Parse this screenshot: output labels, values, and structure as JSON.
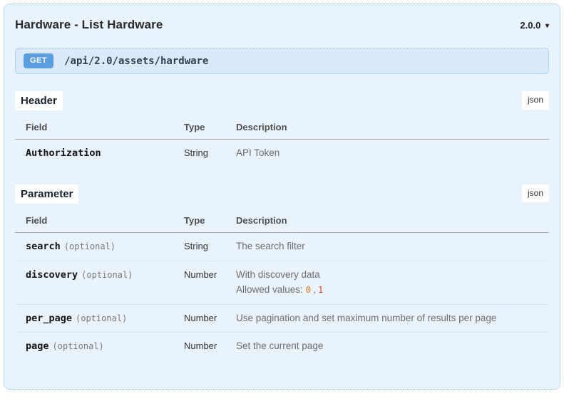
{
  "page": {
    "title": "Hardware - List Hardware",
    "version": "2.0.0",
    "version_caret": "▾"
  },
  "endpoint": {
    "method": "GET",
    "path": "/api/2.0/assets/hardware"
  },
  "header_section": {
    "heading": "Header",
    "json_button_label": "json",
    "columns": {
      "field": "Field",
      "type": "Type",
      "description": "Description"
    },
    "rows": [
      {
        "field": "Authorization",
        "type": "String",
        "description": "API Token"
      }
    ]
  },
  "parameter_section": {
    "heading": "Parameter",
    "json_button_label": "json",
    "columns": {
      "field": "Field",
      "type": "Type",
      "description": "Description"
    },
    "rows": [
      {
        "field": "search",
        "qualifier": "(optional)",
        "type": "String",
        "description": "The search filter"
      },
      {
        "field": "discovery",
        "qualifier": "(optional)",
        "type": "Number",
        "description": "With discovery data",
        "allowed_values_label": "Allowed values:",
        "allowed_values": [
          "0",
          "1"
        ],
        "allowed_values_separator": ","
      },
      {
        "field": "per_page",
        "qualifier": "(optional)",
        "type": "Number",
        "description": "Use pagination and set maximum number of results per page"
      },
      {
        "field": "page",
        "qualifier": "(optional)",
        "type": "Number",
        "description": "Set the current page"
      }
    ]
  },
  "colors": {
    "container_background": "#e9f3fc",
    "dotted_border": "#85bbe8",
    "endpoint_background": "#dbeafa",
    "method_badge_blue": "#5b9fe0",
    "code_value_0_orange": "#e67e22",
    "code_value_1_red": "#e0452e"
  }
}
